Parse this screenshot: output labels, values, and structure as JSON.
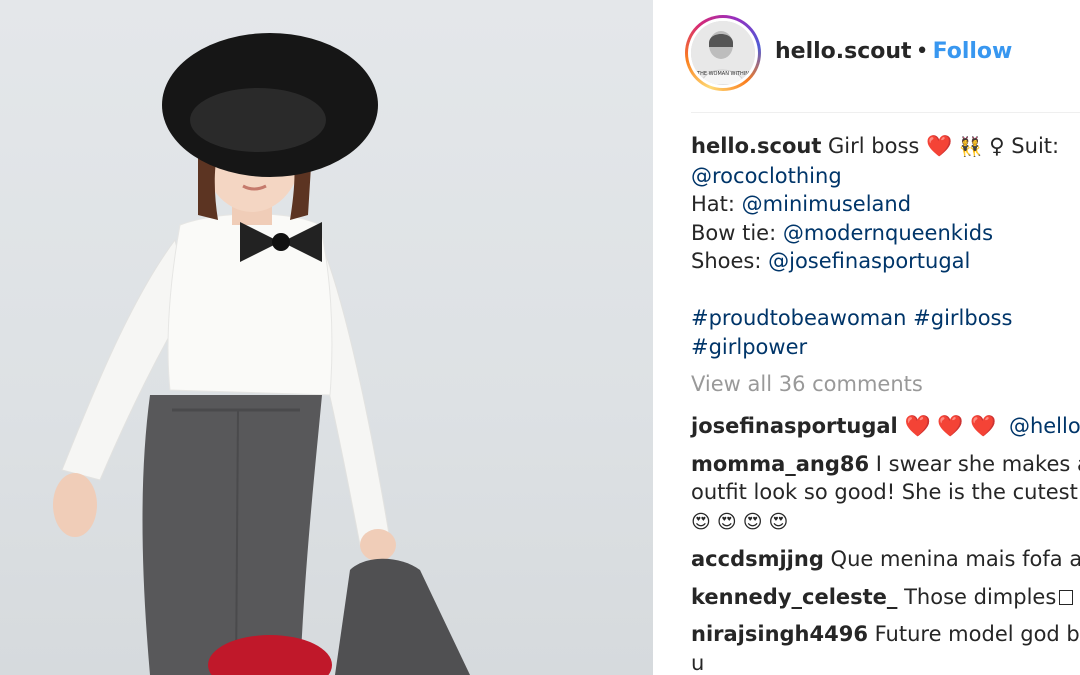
{
  "post": {
    "username": "hello.scout",
    "separator": "•",
    "follow_label": "Follow",
    "avatar_caption": "THE WOMAN WITHIN"
  },
  "caption": {
    "username": "hello.scout",
    "text_1": " Girl boss ",
    "emoji_heart": "❤️",
    "emoji_dancers": "👯",
    "emoji_female": "♀",
    "suit_label": " Suit:",
    "suit_link": "@rococlothing",
    "hat_label": "Hat: ",
    "hat_link": "@minimuseland",
    "bow_label": "Bow tie: ",
    "bow_link": "@modernqueenkids",
    "shoes_label": "Shoes: ",
    "shoes_link": "@josefinasportugal",
    "hashtag_1": "#proudtobeawoman",
    "hashtag_2": "#girlboss",
    "hashtag_3": "#girlpower"
  },
  "view_all_comments": "View all 36 comments",
  "comments": [
    {
      "user": "josefinasportugal",
      "hearts": "❤️ ❤️ ❤️",
      "mention": "@hello.scout"
    },
    {
      "user": "momma_ang86",
      "text_1": " I swear she makes any",
      "text_2": "outfit look so good! She is the cutest!",
      "emojis": "😍 😍 😍 😍"
    },
    {
      "user": "accdsmjjng",
      "text": " Que menina mais fofa aa"
    },
    {
      "user": "kennedy_celeste_",
      "text": " Those dimples"
    },
    {
      "user": "nirajsingh4496",
      "text_1": " Future model god bless",
      "text_2": "u"
    }
  ],
  "colors": {
    "link": "#003569",
    "follow": "#3897f0",
    "text": "#262626",
    "muted": "#999999",
    "divider": "#efefef"
  }
}
